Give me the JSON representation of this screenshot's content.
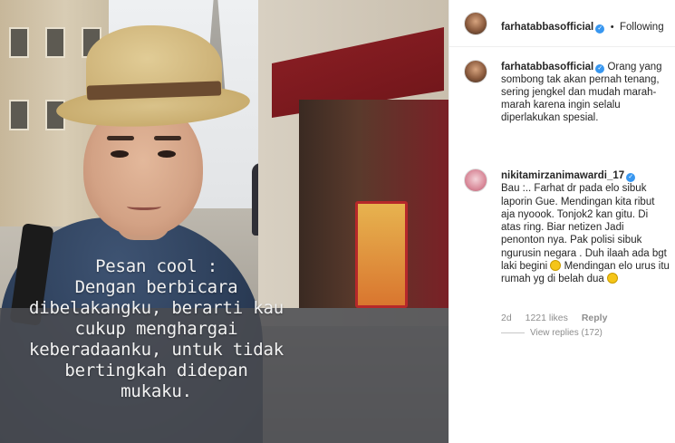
{
  "photo": {
    "caption": "Pesan cool :\nDengan berbicara\ndibelakangku, berarti kau\ncukup menghargai\nkeberadaanku, untuk tidak\nbertingkah didepan\nmukaku."
  },
  "header": {
    "username": "farhatabbasofficial",
    "separator": "•",
    "follow_status": "Following"
  },
  "post": {
    "username": "farhatabbasofficial",
    "caption": "Orang yang sombong tak akan pernah tenang, sering jengkel dan mudah marah-marah karena ingin selalu diperlakukan spesial."
  },
  "comment": {
    "username": "nikitamirzanimawardi_17",
    "text_part1": "Bau :.. Farhat dr pada elo sibuk laporin Gue. Mendingan kita ribut aja nyoook. Tonjok2 kan gitu. Di atas ring. Biar netizen Jadi penonton nya. Pak polisi sibuk ngurusin negara . Duh ilaah ada bgt laki begini",
    "text_part2": "Mendingan elo urus itu rumah yg di belah dua",
    "age": "2d",
    "likes": "1221 likes",
    "reply_label": "Reply",
    "view_replies": "View replies (172)"
  },
  "colors": {
    "verified": "#3897f0",
    "text": "#262626",
    "muted": "#8e8e8e"
  },
  "icons": [
    "verified-badge-icon",
    "emoji-grin-icon"
  ]
}
